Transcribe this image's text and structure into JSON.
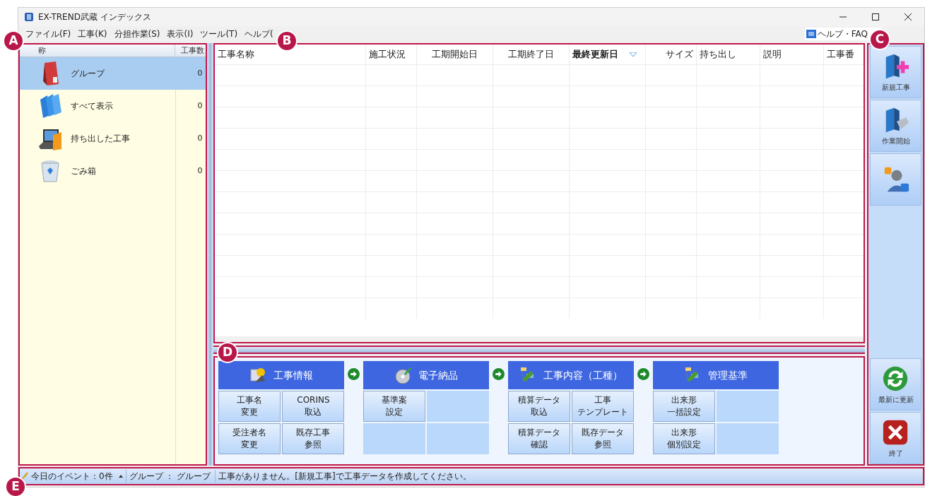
{
  "window": {
    "title": "EX-TREND武蔵 インデックス"
  },
  "menu": [
    "ファイル(F)",
    "工事(K)",
    "分担作業(S)",
    "表示(I)",
    "ツール(T)",
    "ヘルプ("
  ],
  "help_faq": {
    "label": "ヘルプ・FAQ"
  },
  "callouts": [
    "A",
    "B",
    "C",
    "D",
    "E"
  ],
  "sidebar": {
    "columns": [
      "称",
      "工事数"
    ],
    "items": [
      {
        "kind": "group",
        "label": "グループ",
        "count": "0",
        "selected": true
      },
      {
        "kind": "all",
        "label": "すべて表示",
        "count": "0",
        "selected": false
      },
      {
        "kind": "carried",
        "label": "持ち出した工事",
        "count": "0",
        "selected": false
      },
      {
        "kind": "trash",
        "label": "ごみ箱",
        "count": "0",
        "selected": false
      }
    ]
  },
  "table": {
    "columns": [
      {
        "label": "工事名称",
        "sorted": false
      },
      {
        "label": "施工状況",
        "sorted": false
      },
      {
        "label": "工期開始日",
        "sorted": false
      },
      {
        "label": "工期終了日",
        "sorted": false
      },
      {
        "label": "最終更新日",
        "sorted": true
      },
      {
        "label": "サイズ",
        "sorted": false
      },
      {
        "label": "持ち出し",
        "sorted": false
      },
      {
        "label": "説明",
        "sorted": false
      },
      {
        "label": "工事番",
        "sorted": false
      }
    ]
  },
  "workflow": [
    {
      "kind": "info",
      "title": "工事情報",
      "cells": [
        {
          "kind": "button",
          "lines": [
            "工事名",
            "変更"
          ]
        },
        {
          "kind": "button",
          "lines": [
            "CORINS",
            "取込"
          ]
        },
        {
          "kind": "button",
          "lines": [
            "受注者名",
            "変更"
          ]
        },
        {
          "kind": "button",
          "lines": [
            "既存工事",
            "参照"
          ]
        }
      ]
    },
    {
      "kind": "disc",
      "title": "電子納品",
      "cells": [
        {
          "kind": "button",
          "lines": [
            "基準案",
            "設定"
          ]
        },
        {
          "kind": "empty"
        },
        {
          "kind": "empty"
        },
        {
          "kind": "empty"
        }
      ]
    },
    {
      "kind": "folders",
      "title": "工事内容（工種）",
      "cells": [
        {
          "kind": "button",
          "lines": [
            "積算データ",
            "取込"
          ]
        },
        {
          "kind": "button",
          "lines": [
            "工事",
            "テンプレート"
          ]
        },
        {
          "kind": "button",
          "lines": [
            "積算データ",
            "確認"
          ]
        },
        {
          "kind": "button",
          "lines": [
            "既存データ",
            "参照"
          ]
        }
      ]
    },
    {
      "kind": "folders",
      "title": "管理基準",
      "cells": [
        {
          "kind": "button",
          "lines": [
            "出来形",
            "一括設定"
          ]
        },
        {
          "kind": "empty"
        },
        {
          "kind": "button",
          "lines": [
            "出来形",
            "個別設定"
          ]
        },
        {
          "kind": "empty"
        }
      ]
    }
  ],
  "toolbar": {
    "top": [
      {
        "kind": "new",
        "label": "新規工事"
      },
      {
        "kind": "start",
        "label": "作業開始"
      },
      {
        "kind": "support"
      }
    ],
    "bottom": [
      {
        "kind": "refresh",
        "label": "最新に更新"
      },
      {
        "kind": "exit",
        "label": "終了"
      }
    ]
  },
  "status_bar": {
    "event": "今日のイベント：0件",
    "group": "グループ ： グループ",
    "message": "工事がありません。[新規工事]で工事データを作成してください。"
  }
}
